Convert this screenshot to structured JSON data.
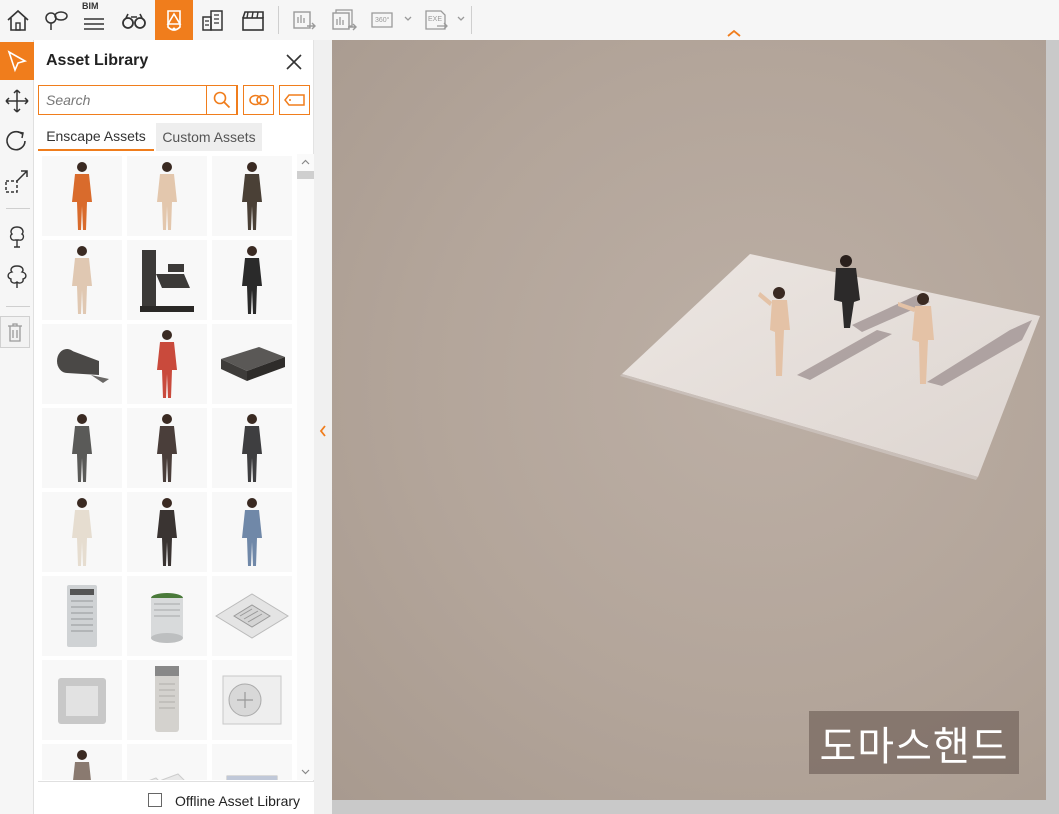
{
  "toolbar": {
    "bim_label": "BIM",
    "buttons": [
      {
        "icon": "home-icon"
      },
      {
        "icon": "map-pin-icon"
      },
      {
        "icon": "bim-list-icon"
      },
      {
        "icon": "binoculars-icon"
      },
      {
        "icon": "asset-library-icon",
        "active": true
      },
      {
        "icon": "buildings-icon"
      },
      {
        "icon": "clapperboard-icon"
      },
      {
        "icon": "batch-render-icon"
      },
      {
        "icon": "batch-render-stack-icon"
      },
      {
        "icon": "panorama-360-icon",
        "text": "360°"
      },
      {
        "icon": "export-exe-icon",
        "text": "EXE"
      }
    ]
  },
  "tools": [
    {
      "icon": "select-cursor-icon",
      "active": true
    },
    {
      "icon": "move-icon"
    },
    {
      "icon": "rotate-icon"
    },
    {
      "icon": "scale-icon"
    },
    {
      "icon": "place-tree-icon"
    },
    {
      "icon": "scatter-trees-icon"
    },
    {
      "icon": "delete-icon"
    }
  ],
  "panel": {
    "title": "Asset Library",
    "search": {
      "placeholder": "Search",
      "value": ""
    },
    "tabs": [
      {
        "label": "Enscape Assets",
        "active": true
      },
      {
        "label": "Custom Assets",
        "active": false
      }
    ],
    "assets": [
      {
        "name": "person-woman-orange-dress",
        "kind": "person",
        "color": "#d96b2c"
      },
      {
        "name": "person-woman-beige-suit",
        "kind": "person",
        "color": "#e3c7ad"
      },
      {
        "name": "person-woman-tablet",
        "kind": "person",
        "color": "#4a4036"
      },
      {
        "name": "person-woman-beige-standing",
        "kind": "person",
        "color": "#e0c8b2"
      },
      {
        "name": "gym-machine",
        "kind": "machine",
        "color": "#3c3a38"
      },
      {
        "name": "person-man-black-shirt",
        "kind": "person",
        "color": "#2a2a2a"
      },
      {
        "name": "foam-roller-mat",
        "kind": "roll",
        "color": "#4a4846"
      },
      {
        "name": "person-child-red",
        "kind": "person",
        "color": "#c94a3c"
      },
      {
        "name": "step-platform",
        "kind": "step",
        "color": "#3e3c3a"
      },
      {
        "name": "person-man-gray-suit",
        "kind": "person",
        "color": "#5a5a58"
      },
      {
        "name": "person-woman-dark-jacket",
        "kind": "person",
        "color": "#4a3e3a"
      },
      {
        "name": "person-woman-gesture",
        "kind": "person",
        "color": "#3e3e40"
      },
      {
        "name": "person-woman-shopping",
        "kind": "person",
        "color": "#e6ddd0"
      },
      {
        "name": "person-waiter-tray",
        "kind": "person",
        "color": "#3a3432"
      },
      {
        "name": "person-woman-blue-dress",
        "kind": "person",
        "color": "#7088a8"
      },
      {
        "name": "air-purifier-box",
        "kind": "purifier",
        "color": "#cfd2d4"
      },
      {
        "name": "air-purifier-round",
        "kind": "round",
        "color": "#d8dadb"
      },
      {
        "name": "ceiling-vent",
        "kind": "vent",
        "color": "#e4e4e4"
      },
      {
        "name": "ceiling-cassette",
        "kind": "cassette",
        "color": "#c8c8c8"
      },
      {
        "name": "air-cooler-tower",
        "kind": "tower",
        "color": "#d4d2ce"
      },
      {
        "name": "ac-outdoor-unit",
        "kind": "acunit",
        "color": "#eeeeee"
      },
      {
        "name": "person-partial",
        "kind": "person",
        "color": "#8a7a70"
      },
      {
        "name": "paper-sheets",
        "kind": "papers",
        "color": "#e8e8e8"
      },
      {
        "name": "box-unit",
        "kind": "box",
        "color": "#c0c8d8"
      }
    ],
    "offline_label": "Offline Asset Library",
    "offline_checked": false
  },
  "viewport": {
    "watermark": "도마스핸드"
  }
}
